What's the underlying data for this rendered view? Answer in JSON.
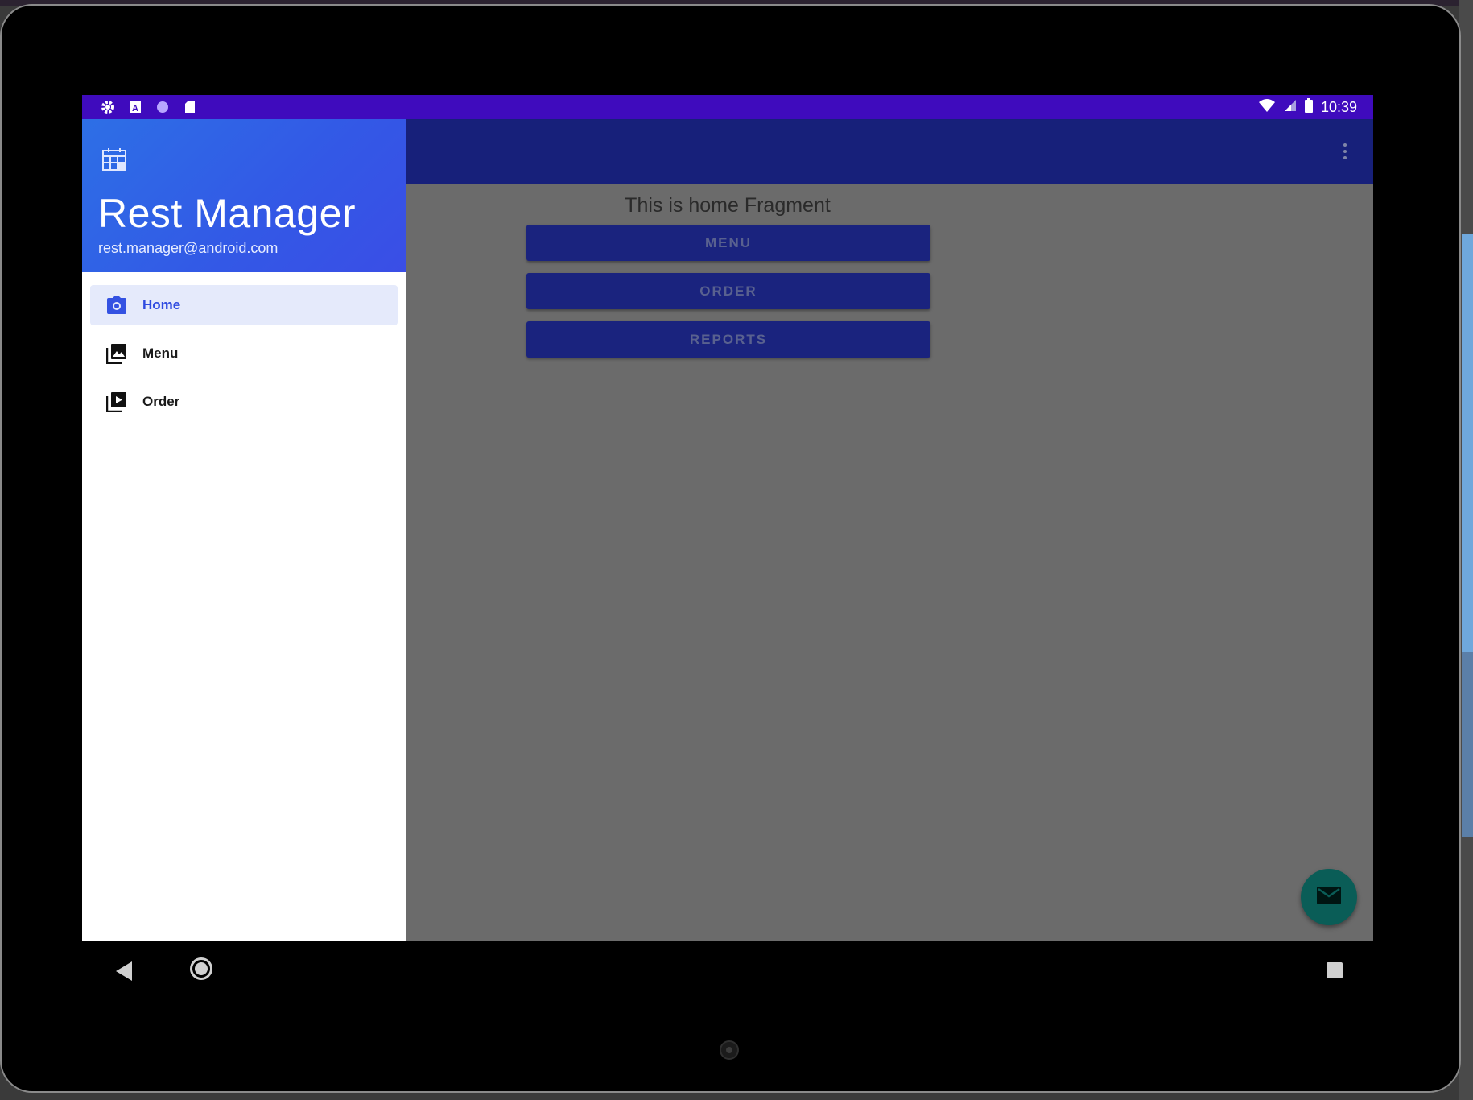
{
  "status_bar": {
    "time": "10:39",
    "left_icons": [
      "gear-icon",
      "a-icon",
      "circle-icon",
      "sd-card-icon"
    ],
    "right_icons": [
      "wifi-icon",
      "signal-icon",
      "battery-icon"
    ]
  },
  "drawer": {
    "header": {
      "icon": "calendar-grid-icon",
      "title": "Rest Manager",
      "email": "rest.manager@android.com"
    },
    "items": [
      {
        "label": "Home",
        "icon": "camera-icon",
        "active": true
      },
      {
        "label": "Menu",
        "icon": "gallery-icon",
        "active": false
      },
      {
        "label": "Order",
        "icon": "slideshow-icon",
        "active": false
      }
    ]
  },
  "content": {
    "title": "This is home Fragment",
    "buttons": [
      "MENU",
      "ORDER",
      "REPORTS"
    ]
  },
  "fab": {
    "icon": "email-icon"
  },
  "nav_bar": {
    "icons": [
      "back-icon",
      "home-icon",
      "recents-icon"
    ]
  },
  "colors": {
    "status_bar": "#3f0bbd",
    "app_bar": "#17207a",
    "drawer_header": "#3358e6",
    "button": "#1a237e",
    "fab": "#0a5d57",
    "active_item_bg": "#e5eafb",
    "scrim_content": "#6b6b6b"
  }
}
